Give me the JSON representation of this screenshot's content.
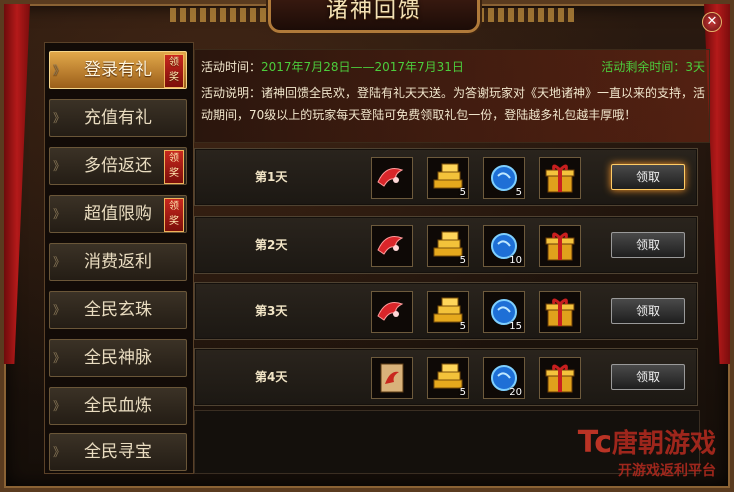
{
  "window": {
    "title": "诸神回馈",
    "close_label": "✕"
  },
  "sidebar": {
    "items": [
      {
        "label": "登录有礼",
        "badge": "领奖",
        "active": true
      },
      {
        "label": "充值有礼",
        "badge": ""
      },
      {
        "label": "多倍返还",
        "badge": "领奖"
      },
      {
        "label": "超值限购",
        "badge": "领奖"
      },
      {
        "label": "消费返利",
        "badge": ""
      },
      {
        "label": "全民玄珠",
        "badge": ""
      },
      {
        "label": "全民神脉",
        "badge": ""
      },
      {
        "label": "全民血炼",
        "badge": ""
      },
      {
        "label": "全民寻宝",
        "badge": ""
      }
    ]
  },
  "info": {
    "time_label": "活动时间：",
    "time_value": "2017年7月28日——2017年7月31日",
    "remain": "活动剩余时间：3天",
    "desc": "活动说明：诸神回馈全民欢，登陆有礼天天送。为答谢玩家对《天地诸神》一直以来的支持，活动期间，70级以上的玩家每天登陆可免费领取礼包一份，登陆越多礼包越丰厚哦！"
  },
  "days": [
    {
      "label": "第1天",
      "items": [
        {
          "icon": "red-wing-icon",
          "count": ""
        },
        {
          "icon": "gold-bars-icon",
          "count": "5"
        },
        {
          "icon": "blue-orb-icon",
          "count": "5"
        },
        {
          "icon": "gift-box-icon",
          "count": ""
        }
      ],
      "claim": "领取",
      "highlight": true
    },
    {
      "label": "第2天",
      "items": [
        {
          "icon": "red-wing-icon",
          "count": ""
        },
        {
          "icon": "gold-bars-icon",
          "count": "5"
        },
        {
          "icon": "blue-orb-icon",
          "count": "10"
        },
        {
          "icon": "gift-box-icon",
          "count": ""
        }
      ],
      "claim": "领取",
      "highlight": false
    },
    {
      "label": "第3天",
      "items": [
        {
          "icon": "red-wing-icon",
          "count": ""
        },
        {
          "icon": "gold-bars-icon",
          "count": "5"
        },
        {
          "icon": "blue-orb-icon",
          "count": "15"
        },
        {
          "icon": "gift-box-icon",
          "count": ""
        }
      ],
      "claim": "领取",
      "highlight": false
    },
    {
      "label": "第4天",
      "items": [
        {
          "icon": "scroll-icon",
          "count": ""
        },
        {
          "icon": "gold-bars-icon",
          "count": "5"
        },
        {
          "icon": "blue-orb-icon",
          "count": "20"
        },
        {
          "icon": "gift-box-icon",
          "count": ""
        }
      ],
      "claim": "领取",
      "highlight": false
    }
  ],
  "watermark": {
    "brand": "Tc",
    "text": "唐朝游戏",
    "sub": "开游戏返利平台"
  }
}
